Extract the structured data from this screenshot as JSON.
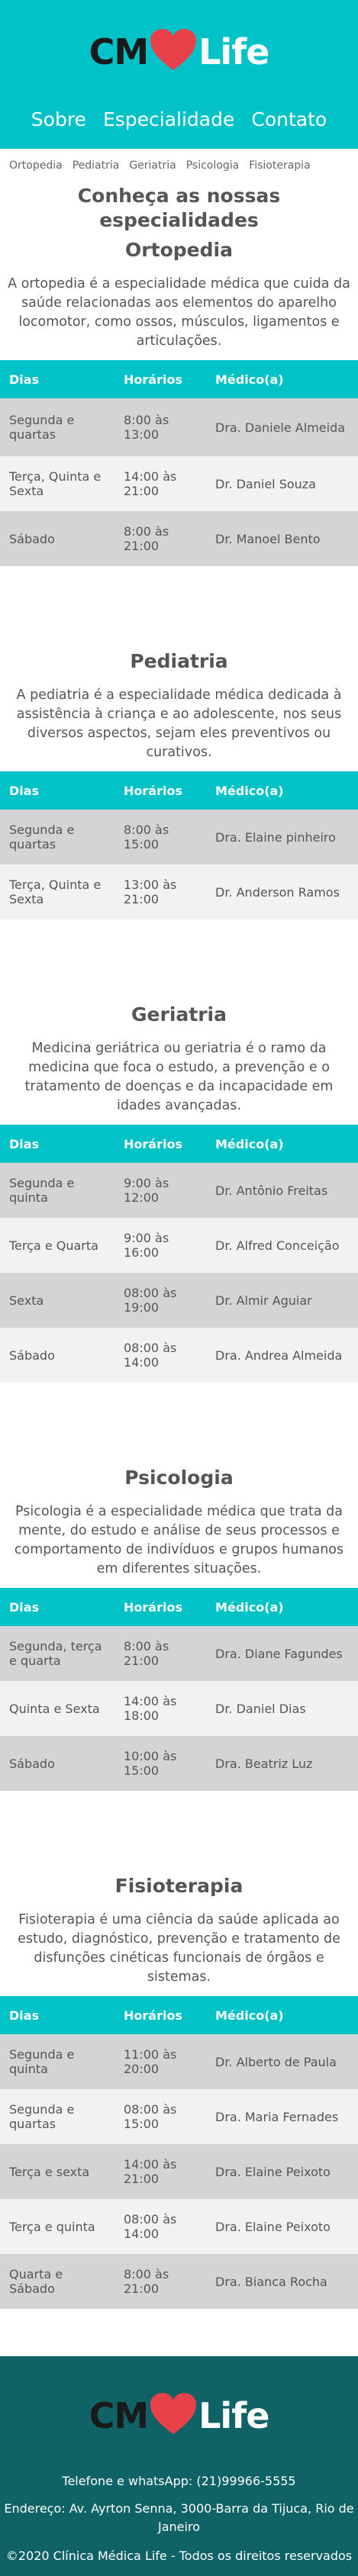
{
  "brand": {
    "left": "CM",
    "right": "Life"
  },
  "nav": {
    "items": [
      "Sobre",
      "Especialidade",
      "Contato"
    ]
  },
  "subnav": {
    "items": [
      "Ortopedia",
      "Pediatria",
      "Geriatria",
      "Psicologia",
      "Fisioterapia"
    ]
  },
  "page_title": "Conheça as nossas especialidades",
  "table_headers": [
    "Dias",
    "Horários",
    "Médico(a)"
  ],
  "specialties": [
    {
      "title": "Ortopedia",
      "description": "A ortopedia é a especialidade médica que cuida da saúde relacionadas aos elementos do aparelho locomotor, como ossos, músculos, ligamentos e articulações.",
      "rows": [
        [
          "Segunda e quartas",
          "8:00 às 13:00",
          "Dra. Daniele Almeida"
        ],
        [
          "Terça, Quinta e Sexta",
          "14:00 às 21:00",
          "Dr. Daniel Souza"
        ],
        [
          "Sábado",
          "8:00 às 21:00",
          "Dr. Manoel Bento"
        ]
      ]
    },
    {
      "title": "Pediatria",
      "description": "A pediatria é a especialidade médica dedicada à assistência à criança e ao adolescente, nos seus diversos aspectos, sejam eles preventivos ou curativos.",
      "rows": [
        [
          "Segunda e quartas",
          "8:00 às 15:00",
          "Dra. Elaine pinheiro"
        ],
        [
          "Terça, Quinta e Sexta",
          "13:00 às 21:00",
          "Dr. Anderson Ramos"
        ]
      ]
    },
    {
      "title": "Geriatria",
      "description": "Medicina geriátrica ou geriatria é o ramo da medicina que foca o estudo, a prevenção e o tratamento de doenças e da incapacidade em idades avançadas.",
      "rows": [
        [
          "Segunda e quinta",
          "9:00 às 12:00",
          "Dr. Antônio Freitas"
        ],
        [
          "Terça e Quarta",
          "9:00 às 16:00",
          "Dr. Alfred Conceição"
        ],
        [
          "Sexta",
          "08:00 às 19:00",
          "Dr. Almir Aguiar"
        ],
        [
          "Sábado",
          "08:00 às 14:00",
          "Dra. Andrea Almeida"
        ]
      ]
    },
    {
      "title": "Psicologia",
      "description": "Psicologia é a especialidade médica que trata da mente, do estudo e análise de seus processos e comportamento de indivíduos e grupos humanos em diferentes situações.",
      "rows": [
        [
          "Segunda, terça e quarta",
          "8:00 às 21:00",
          "Dra. Diane Fagundes"
        ],
        [
          "Quinta e Sexta",
          "14:00 às 18:00",
          "Dr. Daniel Dias"
        ],
        [
          "Sábado",
          "10:00 às 15:00",
          "Dra. Beatriz Luz"
        ]
      ]
    },
    {
      "title": "Fisioterapia",
      "description": "Fisioterapia é uma ciência da saúde aplicada ao estudo, diagnóstico, prevenção e tratamento de disfunções cinéticas funcionais de órgãos e sistemas.",
      "rows": [
        [
          "Segunda e quinta",
          "11:00 às 20:00",
          "Dr. Alberto de Paula"
        ],
        [
          "Segunda e quartas",
          "08:00 às 15:00",
          "Dra. Maria Fernades"
        ],
        [
          "Terça e sexta",
          "14:00 às 21:00",
          "Dra. Elaine Peixoto"
        ],
        [
          "Terça e quinta",
          "08:00 às 14:00",
          "Dra. Elaine Peixoto"
        ],
        [
          "Quarta e Sábado",
          "8:00 às 21:00",
          "Dra. Bianca Rocha"
        ]
      ]
    }
  ],
  "footer": {
    "phone": "Telefone e whatsApp: (21)99966-5555",
    "address": "Endereço: Av. Ayrton Senna, 3000-Barra da Tijuca, Rio de Janeiro",
    "copyright": "©2020 Clínica Médica Life - Todos os direitos reservados"
  },
  "colors": {
    "primary": "#00c2c7",
    "heart": "#e8414a",
    "footer_bg": "#0f6265",
    "row_odd": "#d4d4d4",
    "row_even": "#f2f2f2"
  },
  "icons": {
    "logo_heart": "heart-icon"
  }
}
